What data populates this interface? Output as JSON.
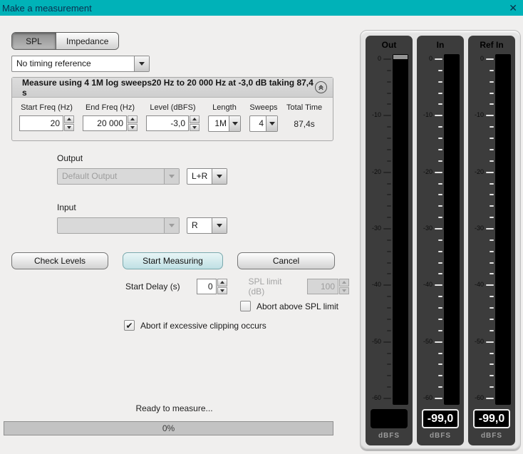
{
  "window": {
    "title": "Make a measurement",
    "close_icon": "✕"
  },
  "tabs": {
    "spl": "SPL",
    "impedance": "Impedance",
    "selected": "SPL"
  },
  "timing_reference": {
    "value": "No timing reference"
  },
  "measure_panel": {
    "header": "Measure using 4 1M log sweeps20 Hz to 20 000 Hz at -3,0 dB taking 87,4 s",
    "fields": {
      "start_freq": {
        "label": "Start Freq (Hz)",
        "value": "20"
      },
      "end_freq": {
        "label": "End Freq (Hz)",
        "value": "20 000"
      },
      "level": {
        "label": "Level (dBFS)",
        "value": "-3,0"
      },
      "length": {
        "label": "Length",
        "value": "1M"
      },
      "sweeps": {
        "label": "Sweeps",
        "value": "4"
      },
      "total_time": {
        "label": "Total Time",
        "value": "87,4s"
      }
    }
  },
  "output": {
    "label": "Output",
    "device_value": "Default Output",
    "device_enabled": false,
    "channel_value": "L+R"
  },
  "input": {
    "label": "Input",
    "device_value": "",
    "device_enabled": false,
    "channel_value": "R"
  },
  "buttons": {
    "check_levels": "Check Levels",
    "start_measuring": "Start Measuring",
    "cancel": "Cancel"
  },
  "start_delay": {
    "label": "Start Delay (s)",
    "value": "0",
    "enabled": true
  },
  "spl_limit": {
    "label": "SPL limit (dB)",
    "value": "100",
    "enabled": false
  },
  "checkboxes": {
    "abort_spl": {
      "label": "Abort above SPL limit",
      "checked": false
    },
    "abort_clipping": {
      "label": "Abort if excessive clipping occurs",
      "checked": true
    }
  },
  "status": {
    "message": "Ready to measure...",
    "progress_label": "0%",
    "progress_percent": 0
  },
  "meters": {
    "scale": {
      "max": 0,
      "min": -60,
      "major_step": 10,
      "minor_step": 2,
      "unit": "dBFS"
    },
    "items": [
      {
        "name": "Out",
        "readout": "",
        "tick_style": "dark",
        "level_marker": true
      },
      {
        "name": "In",
        "readout": "-99,0",
        "tick_style": "light",
        "level_marker": false
      },
      {
        "name": "Ref In",
        "readout": "-99,0",
        "tick_style": "light",
        "level_marker": false
      }
    ]
  }
}
